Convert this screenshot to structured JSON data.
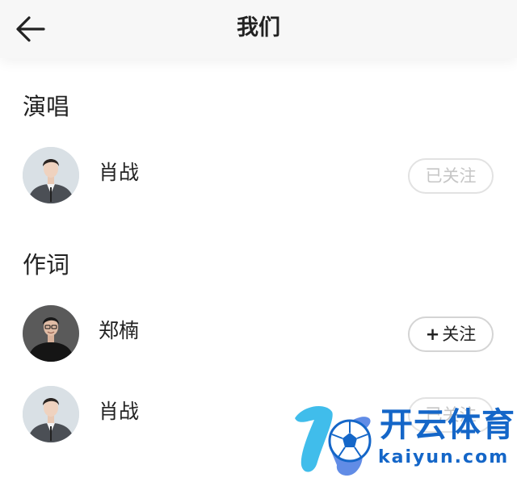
{
  "header": {
    "title": "我们",
    "back_icon": "arrow-left-icon"
  },
  "sections": [
    {
      "title": "演唱",
      "items": [
        {
          "name": "肖战",
          "follow_label": "已关注",
          "followed": true
        }
      ]
    },
    {
      "title": "作词",
      "items": [
        {
          "name": "郑楠",
          "follow_plus": "+",
          "follow_label": "关注",
          "followed": false
        },
        {
          "name": "肖战",
          "follow_label": "已关注",
          "followed": true
        }
      ]
    }
  ],
  "watermark": {
    "brand_cn": "开云体育",
    "brand_en": "kaiyun.com",
    "logo": "k-soccer-ball-logo"
  },
  "colors": {
    "header_bg": "#f7f7f7",
    "followed_text": "#c6c6c6",
    "watermark_blue": "#1466c8"
  }
}
